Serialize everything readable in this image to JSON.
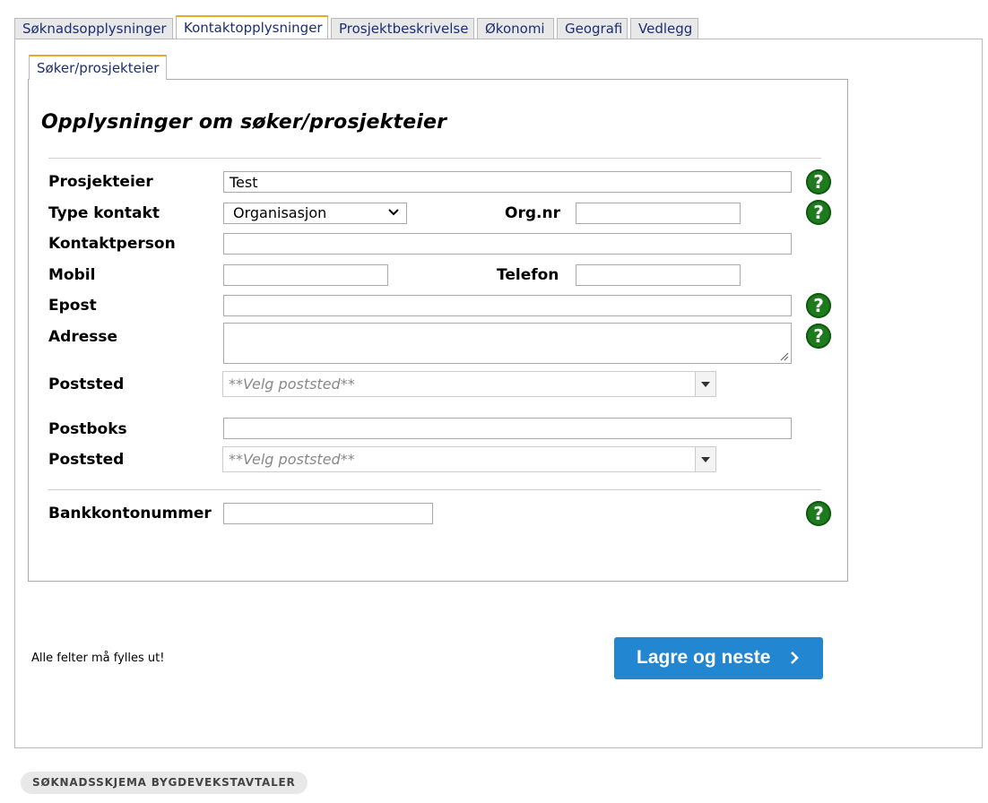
{
  "tabs": [
    "Søknadsopplysninger",
    "Kontaktopplysninger",
    "Prosjektbeskrivelse",
    "Økonomi",
    "Geografi",
    "Vedlegg"
  ],
  "active_tab": "Kontaktopplysninger",
  "subtab": "Søker/prosjekteier",
  "heading": "Opplysninger om søker/prosjekteier",
  "labels": {
    "prosjekteier": "Prosjekteier",
    "type_kontakt": "Type kontakt",
    "org_nr": "Org.nr",
    "kontaktperson": "Kontaktperson",
    "mobil": "Mobil",
    "telefon": "Telefon",
    "epost": "Epost",
    "adresse": "Adresse",
    "poststed": "Poststed",
    "postboks": "Postboks",
    "poststed2": "Poststed",
    "bankkontonummer": "Bankkontonummer"
  },
  "values": {
    "prosjekteier": "Test",
    "type_kontakt": "Organisasjon",
    "org_nr": "",
    "kontaktperson": "",
    "mobil": "",
    "telefon": "",
    "epost": "",
    "adresse": "",
    "postboks": "",
    "bankkontonummer": ""
  },
  "poststed_placeholder": "**Velg poststed**",
  "help_glyph": "?",
  "help_icon": "question-circle-icon",
  "required_note": "Alle felter må fylles ut!",
  "save_button": "Lagre og neste",
  "footer_badge": "SØKNADSSKJEMA BYGDEVEKSTAVTALER",
  "colors": {
    "tab_accent": "#e8a92a",
    "link_text": "#1c2f73",
    "help_green": "#1d7a1d",
    "primary_blue": "#2386d1"
  }
}
